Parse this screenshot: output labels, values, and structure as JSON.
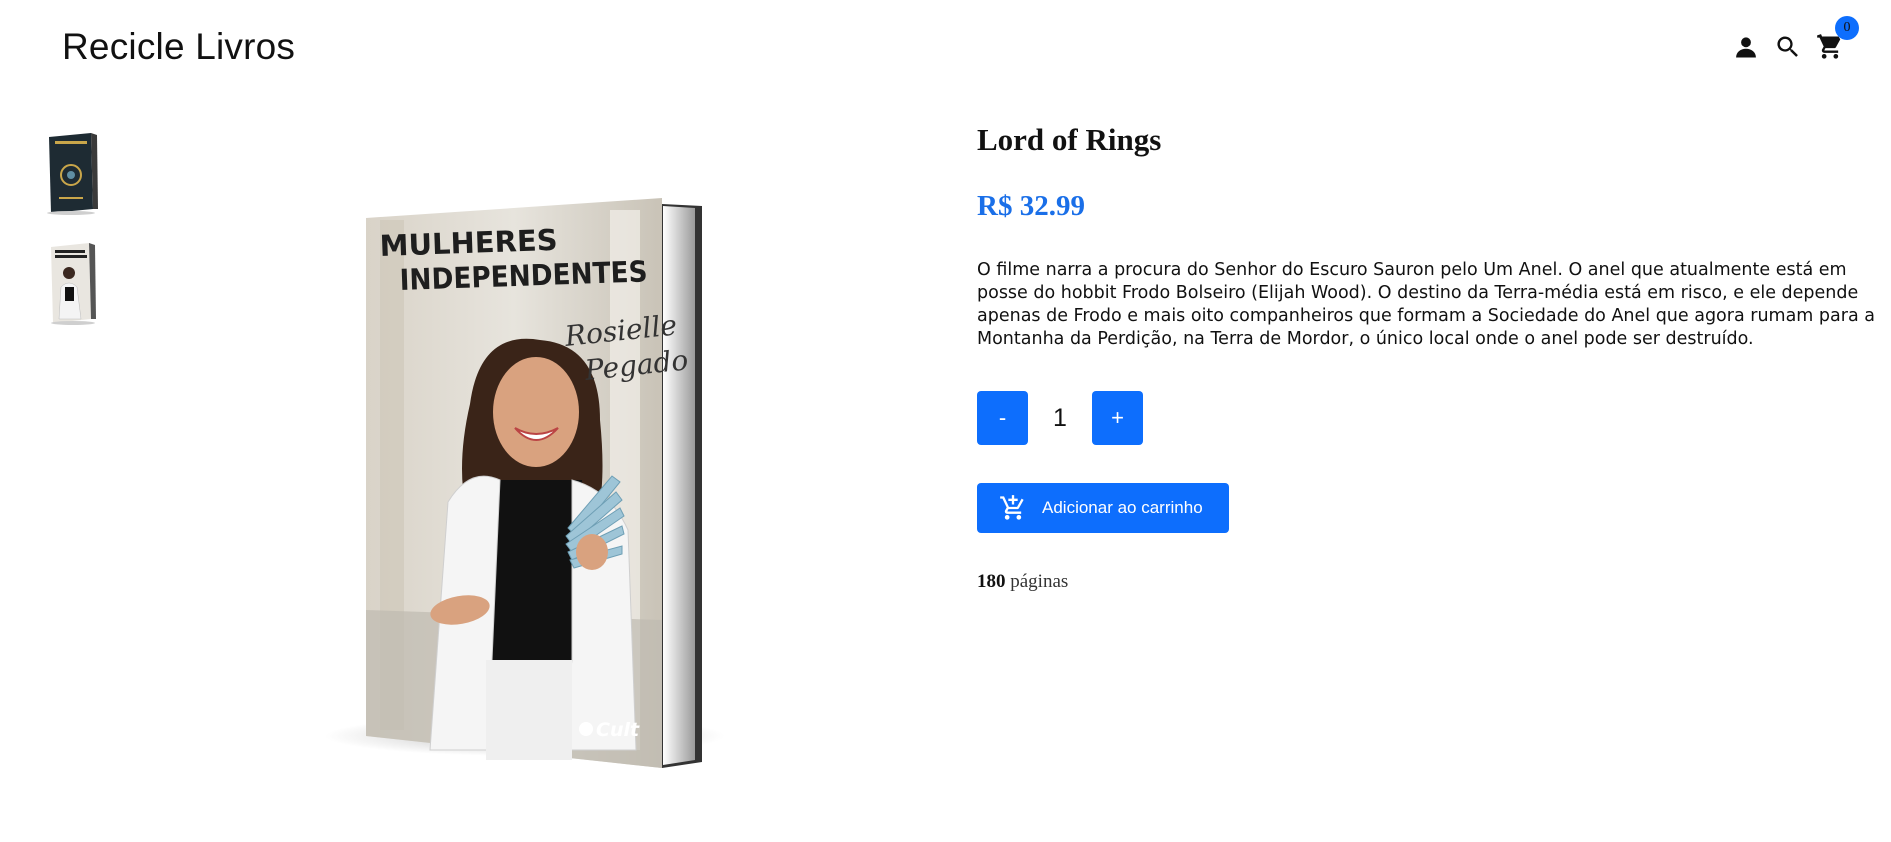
{
  "header": {
    "brand": "Recicle Livros",
    "cart_count": "0",
    "icons": [
      "user-icon",
      "search-icon",
      "cart-icon"
    ]
  },
  "product": {
    "title": "Lord of Rings",
    "price": "R$ 32.99",
    "description": "O filme narra a procura do Senhor do Escuro Sauron pelo Um Anel. O anel que atualmente está em posse do hobbit Frodo Bolseiro (Elijah Wood). O destino da Terra-média está em risco, e ele depende apenas de Frodo e mais oito companheiros que formam a Sociedade do Anel que agora rumam para a Montanha da Perdição, na Terra de Mordor, o único local onde o anel pode ser destruído.",
    "quantity": "1",
    "minus_label": "-",
    "plus_label": "+",
    "add_to_cart_label": "Adicionar ao carrinho",
    "pages_count": "180",
    "pages_label": "páginas"
  },
  "cover": {
    "title_line1": "MULHERES",
    "title_line2": "INDEPENDENTES",
    "author_line1": "Rosielle",
    "author_line2": "Pegado",
    "publisher": "Cult"
  },
  "thumbnails": [
    {
      "name": "thumb-dark-book"
    },
    {
      "name": "thumb-mulheres-independentes"
    }
  ],
  "colors": {
    "accent": "#0d6efd",
    "price": "#1a6fe8"
  }
}
